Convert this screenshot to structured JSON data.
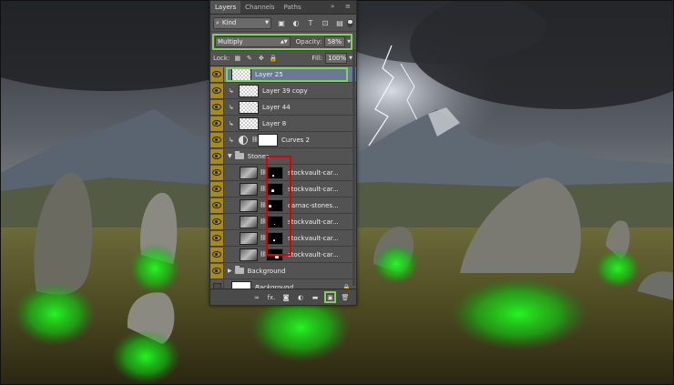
{
  "panel_tabs": [
    "Layers",
    "Channels",
    "Paths"
  ],
  "panel_menu_icons": {
    "collapse": "double-chevron-icon",
    "menu": "hamburger-menu-icon"
  },
  "filter": {
    "kind_label": "Kind",
    "search_glyph": "⌕"
  },
  "blend": {
    "mode": "Multiply",
    "opacity_label": "Opacity:",
    "opacity_value": "58%"
  },
  "lock": {
    "label": "Lock:",
    "fill_label": "Fill:",
    "fill_value": "100%"
  },
  "layers": [
    {
      "name": "Layer 25",
      "selected": true
    },
    {
      "name": "Layer 39 copy"
    },
    {
      "name": "Layer 44"
    },
    {
      "name": "Layer 8"
    },
    {
      "name": "Curves 2"
    },
    {
      "name": "Stones"
    },
    {
      "name": "stockvault-car..."
    },
    {
      "name": "stockvault-car..."
    },
    {
      "name": "carnac-stones..."
    },
    {
      "name": "stockvault-car..."
    },
    {
      "name": "stockvault-car..."
    },
    {
      "name": "stockvault-car..."
    },
    {
      "name": "Background"
    },
    {
      "name": "Background"
    }
  ],
  "bottom_icons": [
    "link-icon",
    "fx-icon",
    "mask-icon",
    "adjustment-icon",
    "folder-icon",
    "new-layer-icon",
    "trash-icon"
  ],
  "bottom_labels": {
    "link": "∞",
    "fx": "fx."
  },
  "colors": {
    "panel": "#535353",
    "highlight_green": "#7fd35a",
    "mask_red": "#e00000",
    "eye_gold": "#a98a18",
    "selected_row": "#6b7a94"
  }
}
